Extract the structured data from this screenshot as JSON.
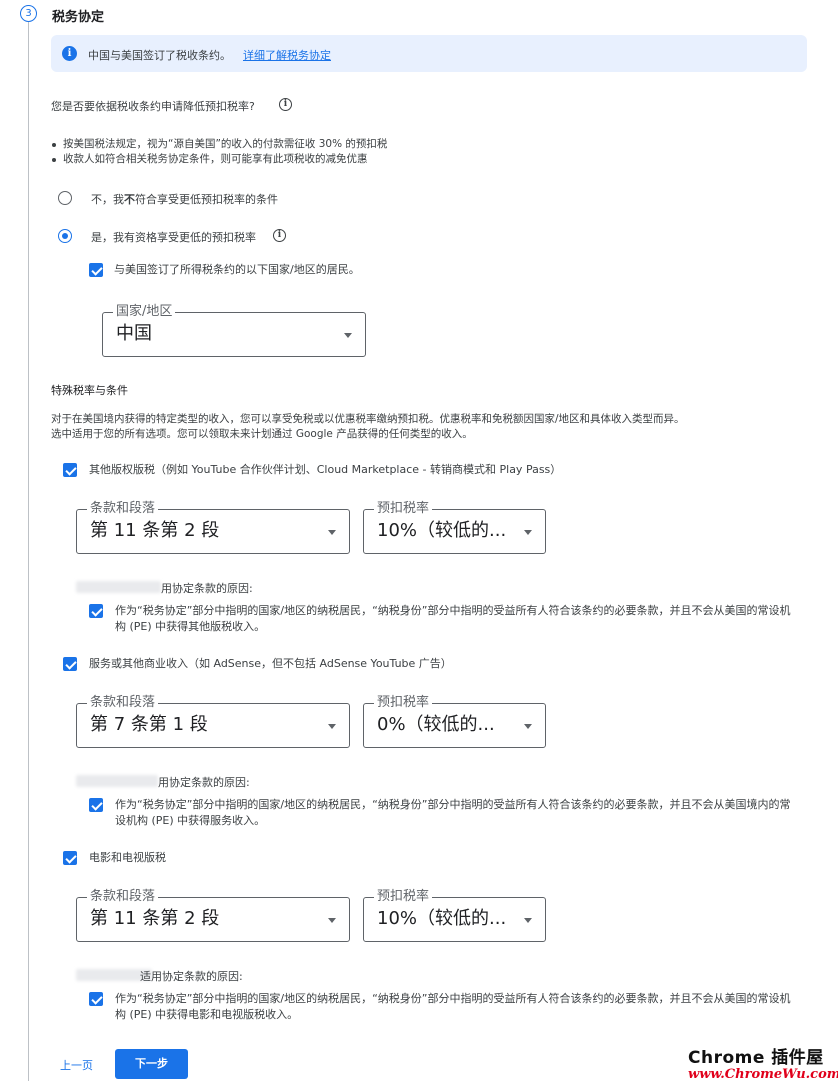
{
  "step": {
    "number": "3",
    "title": "税务协定"
  },
  "info_banner": {
    "icon": "info-icon",
    "text": "中国与美国签订了税收条约。",
    "link": "详细了解税务协定"
  },
  "question": {
    "text": "您是否要依据税收条约申请降低预扣税率?",
    "icon": "help-circle-icon"
  },
  "bullets": [
    "按美国税法规定，视为“源自美国”的收入的付款需征收 30% 的预扣税",
    "收款人如符合相关税务协定条件，则可能享有此项税收的减免优惠"
  ],
  "options": {
    "no": {
      "pre": "不，我",
      "bold": "不",
      "post": "符合享受更低预扣税率的条件",
      "selected": false
    },
    "yes": {
      "label": "是，我有资格享受更低的预扣税率",
      "selected": true
    }
  },
  "resident": {
    "label": "与美国签订了所得税条约的以下国家/地区的居民。",
    "checked": true
  },
  "country_select": {
    "legend": "国家/地区",
    "value": "中国"
  },
  "special": {
    "title": "特殊税率与条件",
    "desc_line1": "对于在美国境内获得的特定类型的收入，您可以享受免税或以优惠税率缴纳预扣税。优惠税率和免税额因国家/地区和具体收入类型而异。",
    "desc_line2": "选中适用于您的所有选项。您可以领取未来计划通过 Google 产品获得的任何类型的收入。"
  },
  "income_types": [
    {
      "label": "其他版权版税（例如 YouTube 合作伙伴计划、Cloud Marketplace - 转销商模式和 Play Pass）",
      "checked": true,
      "article": {
        "legend": "条款和段落",
        "value": "第 11 条第 2 段"
      },
      "rate": {
        "legend": "预扣税率",
        "value": "10%（较低的..."
      },
      "reason_label": "用协定条款的原因:",
      "reason_line1": "作为“税务协定”部分中指明的国家/地区的纳税居民，“纳税身份”部分中指明的受益所有人符合该条约的必要条款，并且不会从美国的常设机",
      "reason_line2": "构 (PE) 中获得其他版税收入。"
    },
    {
      "label": "服务或其他商业收入（如 AdSense，但不包括 AdSense YouTube 广告）",
      "checked": true,
      "article": {
        "legend": "条款和段落",
        "value": "第 7 条第 1 段"
      },
      "rate": {
        "legend": "预扣税率",
        "value": "0%（较低的..."
      },
      "reason_label": "用协定条款的原因:",
      "reason_line1": "作为“税务协定”部分中指明的国家/地区的纳税居民，“纳税身份”部分中指明的受益所有人符合该条约的必要条款，并且不会从美国境内的常",
      "reason_line2": "设机构 (PE) 中获得服务收入。"
    },
    {
      "label": "电影和电视版税",
      "checked": true,
      "article": {
        "legend": "条款和段落",
        "value": "第 11 条第 2 段"
      },
      "rate": {
        "legend": "预扣税率",
        "value": "10%（较低的..."
      },
      "reason_label": "适用协定条款的原因:",
      "reason_line1": "作为“税务协定”部分中指明的国家/地区的纳税居民，“纳税身份”部分中指明的受益所有人符合该条约的必要条款，并且不会从美国的常设机",
      "reason_line2": "构 (PE) 中获得电影和电视版税收入。"
    }
  ],
  "nav": {
    "prev": "上一页",
    "next": "下一步"
  },
  "watermark": {
    "top": "Chrome 插件屋",
    "bottom": "www.ChromeWu.com"
  }
}
